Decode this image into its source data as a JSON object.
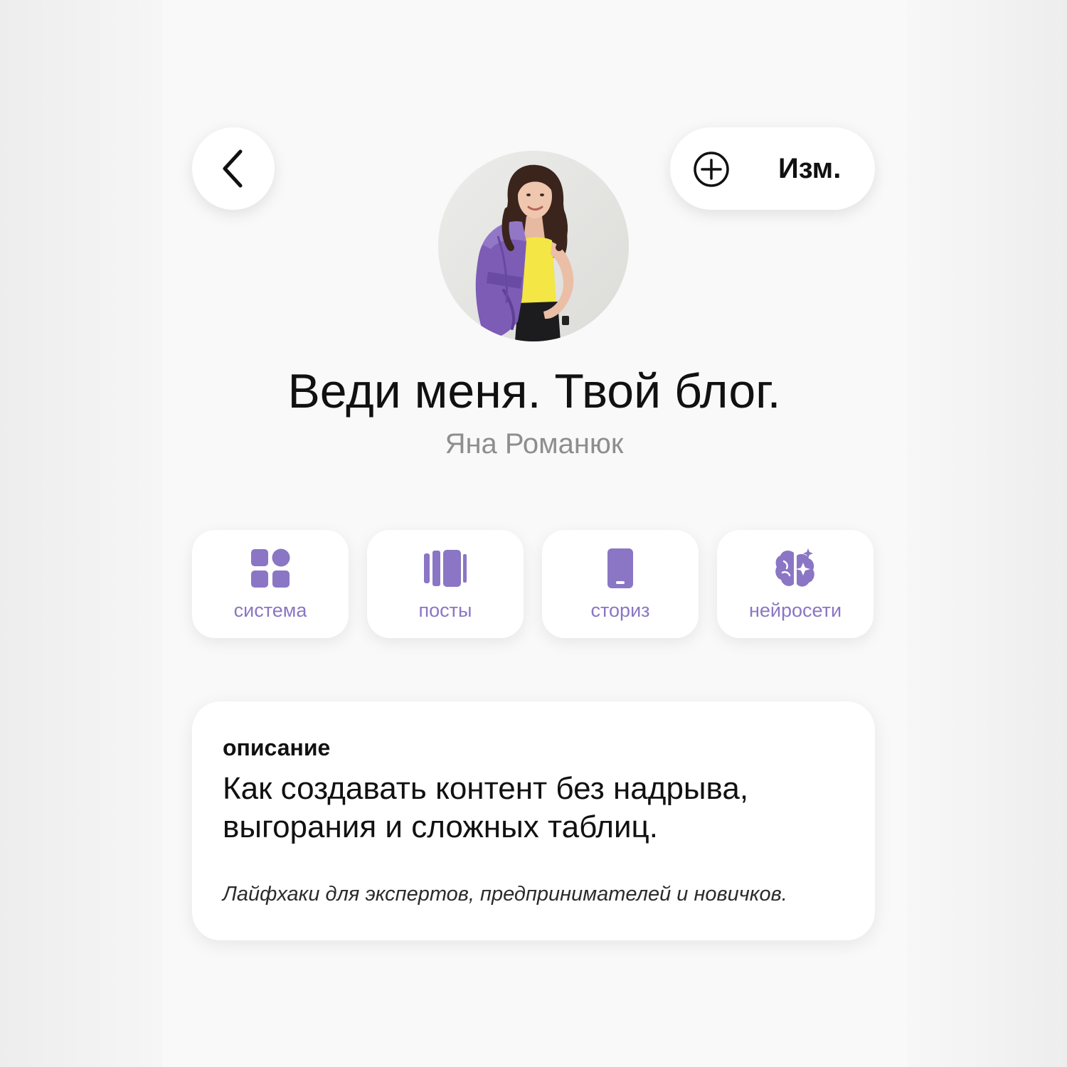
{
  "header": {
    "back_icon": "chevron-left-icon",
    "edit_icon": "plus-circle-icon",
    "edit_label": "Изм."
  },
  "profile": {
    "title": "Веди меня. Твой блог.",
    "author": "Яна Романюк"
  },
  "categories": [
    {
      "label": "система",
      "icon": "grid-icon"
    },
    {
      "label": "посты",
      "icon": "carousel-icon"
    },
    {
      "label": "сториз",
      "icon": "phone-icon"
    },
    {
      "label": "нейросети",
      "icon": "brain-sparkle-icon"
    }
  ],
  "description": {
    "heading": "описание",
    "text": "Как создавать контент без надрыва, выгорания и сложных таблиц.",
    "note": "Лайфхаки для экспертов, предпринимателей и новичков."
  },
  "colors": {
    "accent": "#8a76c4",
    "background": "#f9f9f9",
    "card": "#ffffff",
    "text": "#111111",
    "muted": "#8e8e8e"
  }
}
